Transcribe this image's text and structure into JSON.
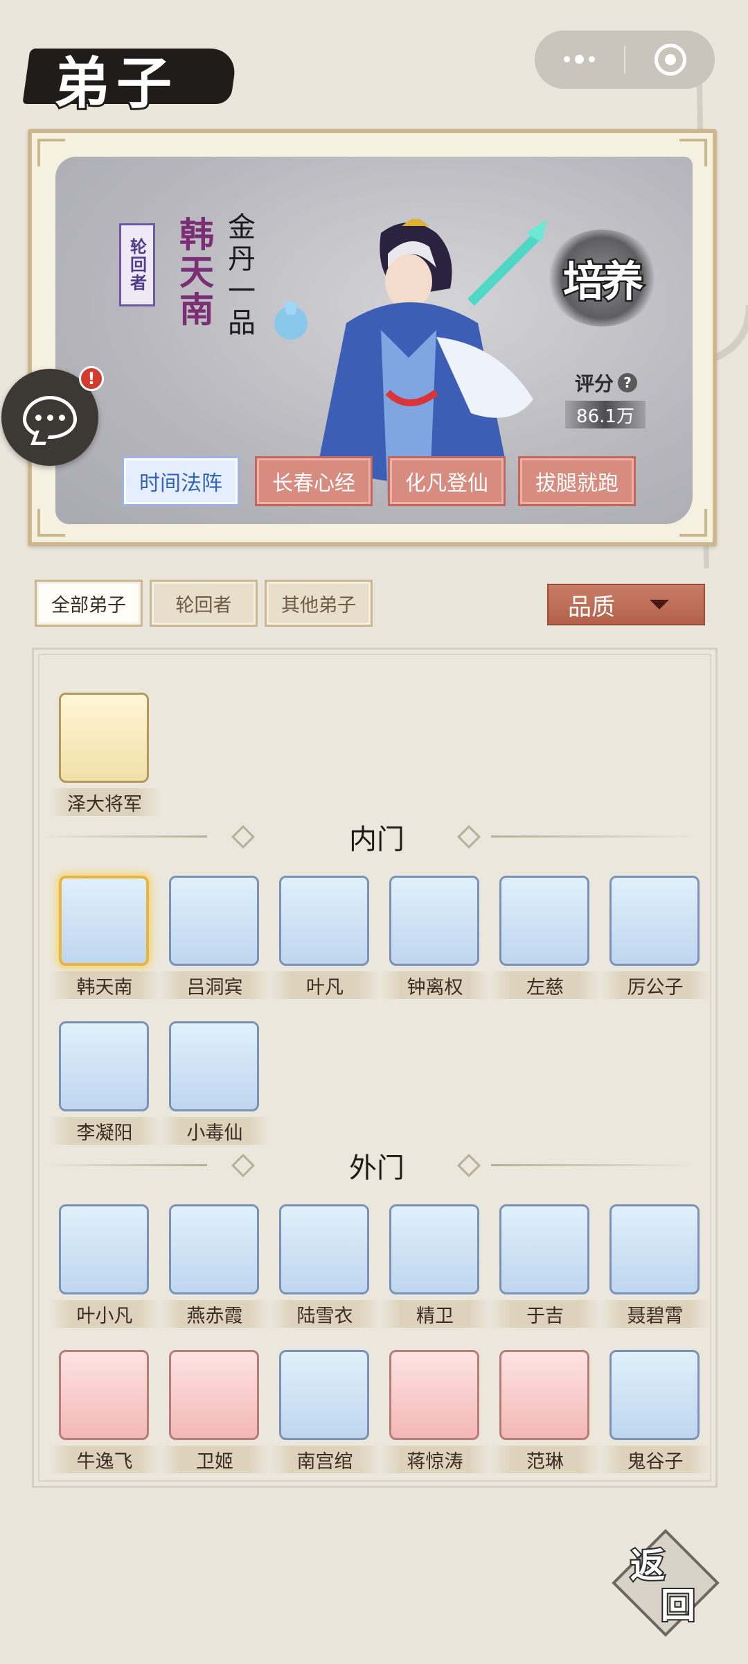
{
  "header": {
    "title": "弟子"
  },
  "capsule": {
    "more_icon": "more-dots-icon",
    "close_icon": "record-circle-icon"
  },
  "hero": {
    "seal": "轮回者",
    "name": "韩天南",
    "rank": "金丹一品",
    "cultivate_label": "培养",
    "score_label": "评分",
    "score_value": "86.1万",
    "skills": [
      "时间法阵",
      "长春心经",
      "化凡登仙",
      "拔腿就跑"
    ]
  },
  "chat": {
    "badge": "!"
  },
  "filters": {
    "tabs": [
      "全部弟子",
      "轮回者",
      "其他弟子"
    ],
    "active": 0,
    "quality_label": "品质"
  },
  "sections": {
    "top": {
      "disciples": [
        "泽大将军"
      ]
    },
    "inner": {
      "title": "内门",
      "disciples": [
        "韩天南",
        "吕洞宾",
        "叶凡",
        "钟离权",
        "左慈",
        "厉公子",
        "李凝阳",
        "小毒仙"
      ]
    },
    "outer": {
      "title": "外门",
      "disciples": [
        "叶小凡",
        "燕赤霞",
        "陆雪衣",
        "精卫",
        "于吉",
        "聂碧霄",
        "牛逸飞",
        "卫姬",
        "南宫绾",
        "蒋惊涛",
        "范琳",
        "鬼谷子"
      ]
    }
  },
  "back": {
    "label_1": "返",
    "label_2": "回"
  },
  "colors": {
    "background": "#ebe6dc",
    "skill_red": "#d88b7f",
    "skill_active_text": "#3662b8",
    "quality_button": "#b4614b",
    "selected_border": "#e8b640"
  }
}
